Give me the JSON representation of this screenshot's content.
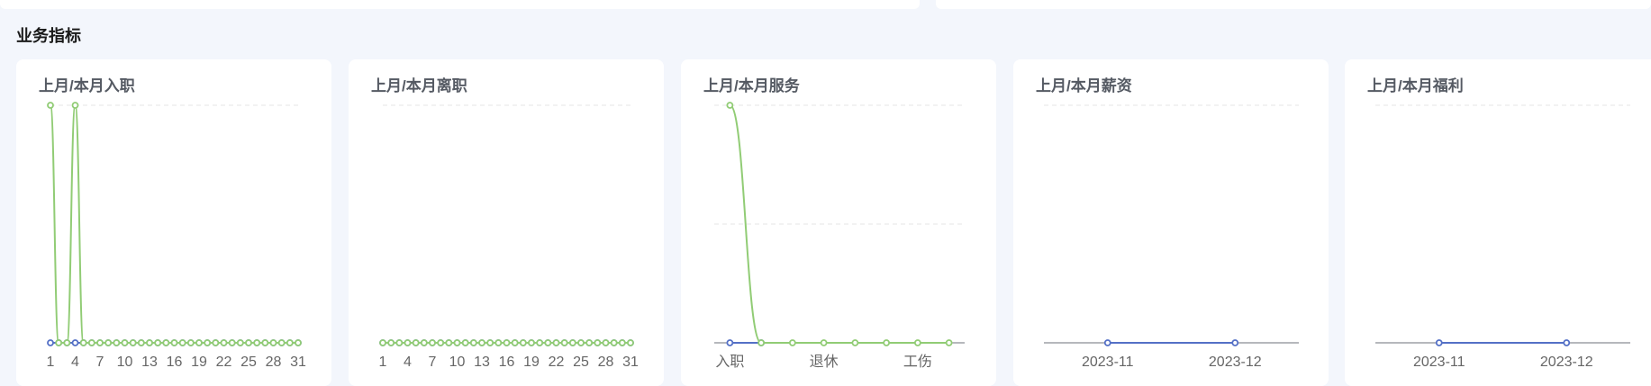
{
  "section": {
    "title": "业务指标"
  },
  "colors": {
    "last_month": "#5470c6",
    "this_month": "#91cc75",
    "grid": "#e6e6e6",
    "axis": "#6e7079"
  },
  "chart_data": [
    {
      "type": "line",
      "title": "上月/本月入职",
      "x": [
        1,
        2,
        3,
        4,
        5,
        6,
        7,
        8,
        9,
        10,
        11,
        12,
        13,
        14,
        15,
        16,
        17,
        18,
        19,
        20,
        21,
        22,
        23,
        24,
        25,
        26,
        27,
        28,
        29,
        30,
        31
      ],
      "xticks": [
        "1",
        "4",
        "7",
        "10",
        "13",
        "16",
        "19",
        "22",
        "25",
        "28",
        "31"
      ],
      "ylim": [
        0,
        1
      ],
      "smooth": true,
      "series": [
        {
          "color": "#5470c6",
          "values": [
            0,
            0,
            0,
            0,
            0,
            0,
            0,
            0,
            0,
            0,
            0,
            0,
            0,
            0,
            0,
            0,
            0,
            0,
            0,
            0,
            0,
            0,
            0,
            0,
            0,
            0,
            0,
            0,
            0,
            0,
            0
          ]
        },
        {
          "color": "#91cc75",
          "values": [
            1,
            0,
            0,
            1,
            0,
            0,
            0,
            0,
            0,
            0,
            0,
            0,
            0,
            0,
            0,
            0,
            0,
            0,
            0,
            0,
            0,
            0,
            0,
            0,
            0,
            0,
            0,
            0,
            0,
            0,
            0
          ]
        }
      ]
    },
    {
      "type": "line",
      "title": "上月/本月离职",
      "x": [
        1,
        2,
        3,
        4,
        5,
        6,
        7,
        8,
        9,
        10,
        11,
        12,
        13,
        14,
        15,
        16,
        17,
        18,
        19,
        20,
        21,
        22,
        23,
        24,
        25,
        26,
        27,
        28,
        29,
        30,
        31
      ],
      "xticks": [
        "1",
        "4",
        "7",
        "10",
        "13",
        "16",
        "19",
        "22",
        "25",
        "28",
        "31"
      ],
      "ylim": [
        0,
        1
      ],
      "smooth": true,
      "series": [
        {
          "color": "#5470c6",
          "values": [
            0,
            0,
            0,
            0,
            0,
            0,
            0,
            0,
            0,
            0,
            0,
            0,
            0,
            0,
            0,
            0,
            0,
            0,
            0,
            0,
            0,
            0,
            0,
            0,
            0,
            0,
            0,
            0,
            0,
            0,
            0
          ]
        },
        {
          "color": "#91cc75",
          "values": [
            0,
            0,
            0,
            0,
            0,
            0,
            0,
            0,
            0,
            0,
            0,
            0,
            0,
            0,
            0,
            0,
            0,
            0,
            0,
            0,
            0,
            0,
            0,
            0,
            0,
            0,
            0,
            0,
            0,
            0,
            0
          ]
        }
      ]
    },
    {
      "type": "line",
      "title": "上月/本月服务",
      "categories_count": 8,
      "xticks": [
        "入职",
        "退休",
        "工伤"
      ],
      "xtick_positions": [
        0,
        3,
        6
      ],
      "ylim": [
        0,
        2
      ],
      "grid_lines": 2,
      "smooth": true,
      "series": [
        {
          "color": "#5470c6",
          "values": [
            0,
            0
          ]
        },
        {
          "color": "#91cc75",
          "values": [
            2,
            0,
            0,
            0,
            0,
            0,
            0,
            0
          ]
        }
      ]
    },
    {
      "type": "line",
      "title": "上月/本月薪资",
      "categories": [
        "2023-11",
        "2023-12"
      ],
      "xticks": [
        "2023-11",
        "2023-12"
      ],
      "ylim": [
        0,
        1
      ],
      "series": [
        {
          "color": "#5470c6",
          "values": [
            0,
            0
          ]
        }
      ]
    },
    {
      "type": "line",
      "title": "上月/本月福利",
      "categories": [
        "2023-11",
        "2023-12"
      ],
      "xticks": [
        "2023-11",
        "2023-12"
      ],
      "ylim": [
        0,
        1
      ],
      "series": [
        {
          "color": "#5470c6",
          "values": [
            0,
            0
          ]
        }
      ]
    }
  ]
}
